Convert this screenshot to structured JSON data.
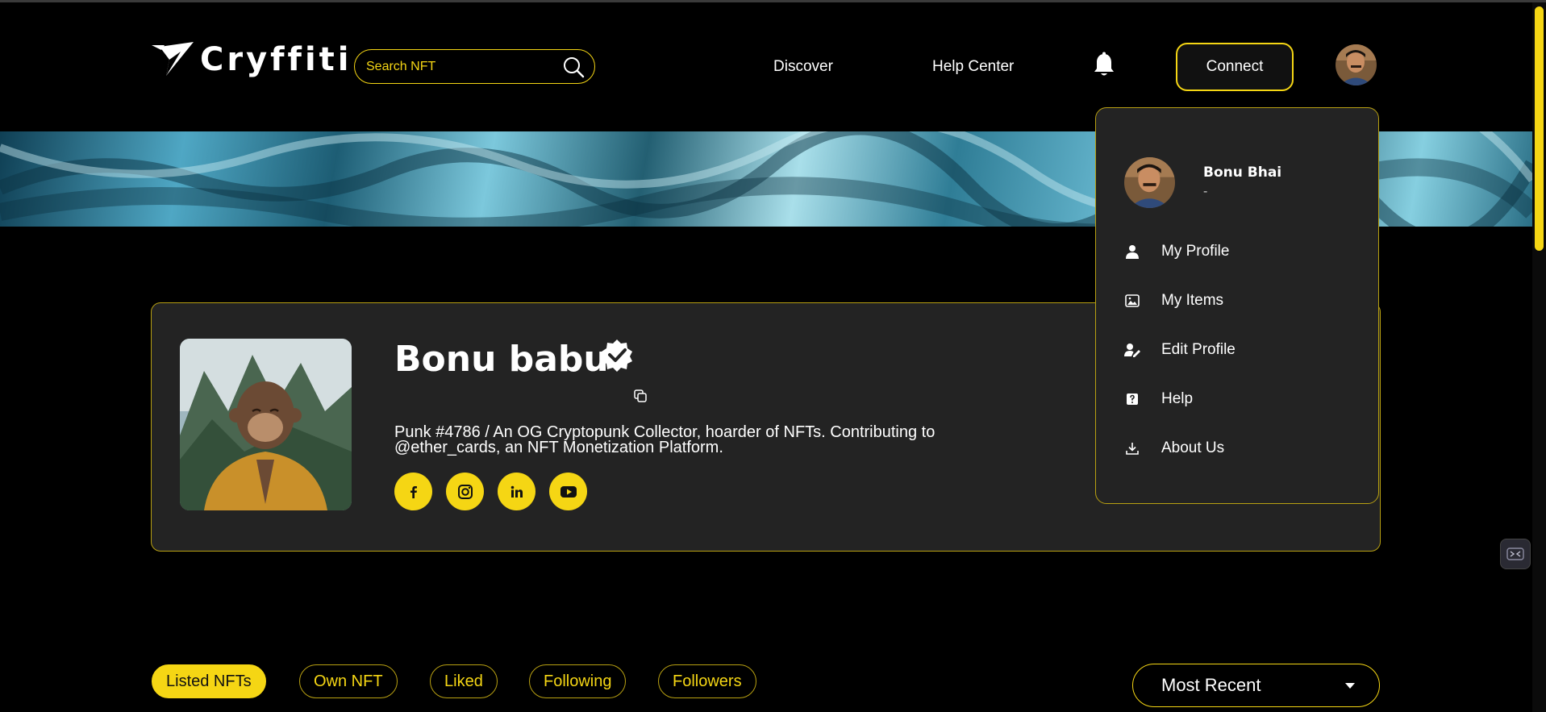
{
  "brand": {
    "name": "Cryffiti"
  },
  "search": {
    "placeholder": "Search NFT"
  },
  "nav": {
    "discover": "Discover",
    "help_center": "Help Center",
    "connect": "Connect"
  },
  "profile": {
    "name": "Bonu babu",
    "bio": "Punk #4786 / An OG Cryptopunk Collector, hoarder of NFTs. Contributing to @ether_cards, an NFT Monetization Platform.",
    "socials": [
      "facebook-icon",
      "instagram-icon",
      "linkedin-icon",
      "youtube-icon"
    ]
  },
  "dropdown": {
    "user_name": "Bonu Bhai",
    "user_sub": "-",
    "items": [
      {
        "label": "My Profile",
        "icon": "user-icon"
      },
      {
        "label": "My Items",
        "icon": "image-icon"
      },
      {
        "label": "Edit Profile",
        "icon": "user-edit-icon"
      },
      {
        "label": "Help",
        "icon": "question-icon"
      },
      {
        "label": "About Us",
        "icon": "download-icon"
      }
    ]
  },
  "tabs": [
    {
      "label": "Listed NFTs",
      "active": true
    },
    {
      "label": "Own NFT",
      "active": false
    },
    {
      "label": "Liked",
      "active": false
    },
    {
      "label": "Following",
      "active": false
    },
    {
      "label": "Followers",
      "active": false
    }
  ],
  "sort": {
    "selected": "Most Recent"
  },
  "colors": {
    "accent": "#f5d614",
    "background": "#000000",
    "card": "#232323",
    "border": "#b8a012"
  }
}
